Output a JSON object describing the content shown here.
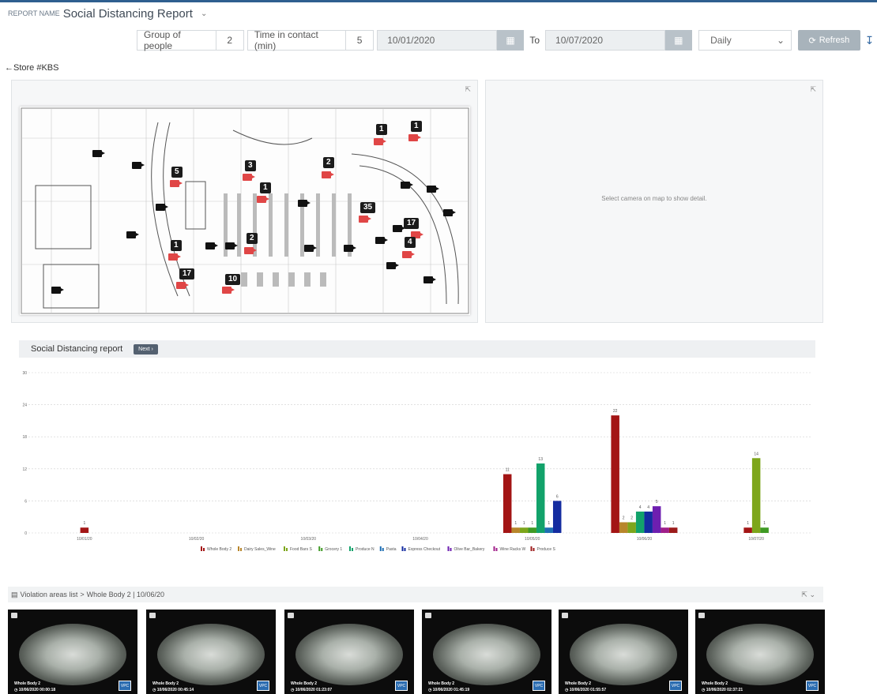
{
  "header": {
    "report_label": "REPORT NAME",
    "report_title": "Social Distancing Report"
  },
  "filters": {
    "group_label": "Group of people",
    "group_value": "2",
    "contact_label": "Time in contact (min)",
    "contact_value": "5",
    "date_from": "10/01/2020",
    "to_label": "To",
    "date_to": "10/07/2020",
    "interval": "Daily",
    "refresh_label": "Refresh"
  },
  "back_link": "Store #KBS",
  "map": {
    "badges": [
      "1",
      "1",
      "5",
      "3",
      "2",
      "1",
      "35",
      "17",
      "4",
      "1",
      "2",
      "17",
      "10"
    ]
  },
  "detail": {
    "message": "Select camera on map to show detail."
  },
  "chart_header": {
    "title": "Social Distancing report",
    "next_label": "Next ›"
  },
  "chart_data": {
    "type": "bar",
    "title": "",
    "ylim": [
      0,
      30
    ],
    "y_ticks": [
      0,
      6,
      12,
      18,
      24,
      30
    ],
    "x_ticks": [
      "10/01/20",
      "10/02/20",
      "10/03/20",
      "10/04/20",
      "10/05/20",
      "10/06/20",
      "10/07/20"
    ],
    "legend_position": "bottom",
    "grid": true,
    "series": [
      {
        "name": "Whole Body 2",
        "color": "#a31515"
      },
      {
        "name": "Dairy Sales_Wine",
        "color": "#b8862b"
      },
      {
        "name": "Food Bars S",
        "color": "#7da61b"
      },
      {
        "name": "Grocery 1",
        "color": "#3f9a24"
      },
      {
        "name": "Produce N",
        "color": "#12a26a"
      },
      {
        "name": "Pasta",
        "color": "#1e6fb4"
      },
      {
        "name": "Express Checkout",
        "color": "#142ca0"
      },
      {
        "name": "Olive Bar_Bakery",
        "color": "#6e1fb0"
      },
      {
        "name": "Wine Racks W",
        "color": "#a01f8a"
      },
      {
        "name": "Produce S",
        "color": "#9c1b1b"
      }
    ],
    "bars": [
      {
        "date": "10/01/20",
        "series": "Whole Body 2",
        "value": 1
      },
      {
        "date": "10/05/20",
        "series": "Whole Body 2",
        "value": 11
      },
      {
        "date": "10/05/20",
        "series": "Dairy Sales_Wine",
        "value": 1
      },
      {
        "date": "10/05/20",
        "series": "Food Bars S",
        "value": 1
      },
      {
        "date": "10/05/20",
        "series": "Grocery 1",
        "value": 1
      },
      {
        "date": "10/05/20",
        "series": "Produce N",
        "value": 13
      },
      {
        "date": "10/05/20",
        "series": "Pasta",
        "value": 1
      },
      {
        "date": "10/05/20",
        "series": "Express Checkout",
        "value": 6
      },
      {
        "date": "10/06/20",
        "series": "Whole Body 2",
        "value": 22
      },
      {
        "date": "10/06/20",
        "series": "Dairy Sales_Wine",
        "value": 2
      },
      {
        "date": "10/06/20",
        "series": "Food Bars S",
        "value": 2
      },
      {
        "date": "10/06/20",
        "series": "Produce N",
        "value": 4
      },
      {
        "date": "10/06/20",
        "series": "Express Checkout",
        "value": 4
      },
      {
        "date": "10/06/20",
        "series": "Olive Bar_Bakery",
        "value": 5
      },
      {
        "date": "10/06/20",
        "series": "Wine Racks W",
        "value": 1
      },
      {
        "date": "10/06/20",
        "series": "Produce S",
        "value": 1
      },
      {
        "date": "10/07/20",
        "series": "Whole Body 2",
        "value": 1
      },
      {
        "date": "10/07/20",
        "series": "Food Bars S",
        "value": 14
      },
      {
        "date": "10/07/20",
        "series": "Grocery 1",
        "value": 1
      }
    ]
  },
  "violations": {
    "header_label": "Violation areas list",
    "header_path": "Whole Body 2 | 10/06/20",
    "items": [
      {
        "name": "Whole Body 2",
        "time": "10/06/2020 00:00:18",
        "tag": "VPC"
      },
      {
        "name": "Whole Body 2",
        "time": "10/06/2020 00:45:14",
        "tag": "VPC"
      },
      {
        "name": "Whole Body 2",
        "time": "10/06/2020 01:23:07",
        "tag": "VPC"
      },
      {
        "name": "Whole Body 2",
        "time": "10/06/2020 01:45:19",
        "tag": "VPC"
      },
      {
        "name": "Whole Body 2",
        "time": "10/06/2020 01:55:57",
        "tag": "VPC"
      },
      {
        "name": "Whole Body 2",
        "time": "10/06/2020 02:37:21",
        "tag": "VPC"
      }
    ]
  }
}
